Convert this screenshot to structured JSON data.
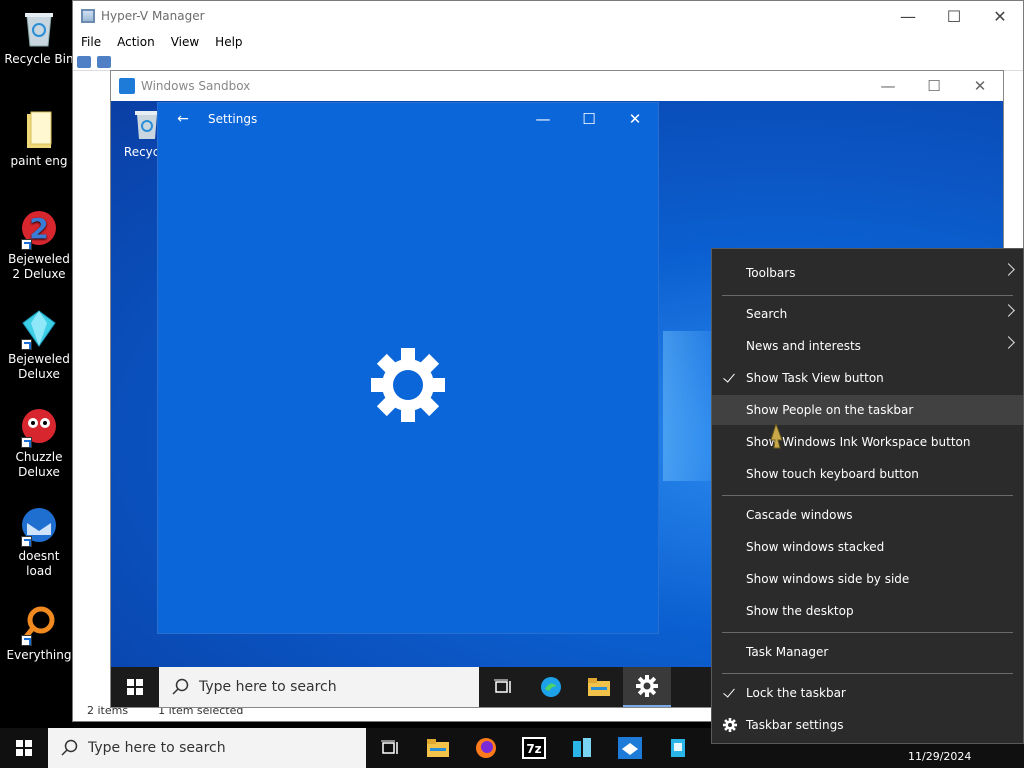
{
  "desktop": {
    "icons": [
      {
        "label": "Recycle Bin",
        "icon": "recycle-bin-icon"
      },
      {
        "label": "paint eng",
        "icon": "folder-icon"
      },
      {
        "label": "Bejeweled 2 Deluxe",
        "icon": "bejeweled2-icon"
      },
      {
        "label": "Bejeweled Deluxe",
        "icon": "bejeweled-icon"
      },
      {
        "label": "Chuzzle Deluxe",
        "icon": "chuzzle-icon"
      },
      {
        "label": "doesnt load",
        "icon": "thunderbird-icon"
      },
      {
        "label": "Everything",
        "icon": "everything-search-icon"
      }
    ]
  },
  "hyperv": {
    "title": "Hyper-V Manager",
    "menu": [
      "File",
      "Action",
      "View",
      "Help"
    ],
    "status_items": "2 items",
    "status_selected": "1 item selected"
  },
  "sandbox": {
    "title": "Windows Sandbox",
    "recycle_label": "Recycle",
    "search_placeholder": "Type here to search"
  },
  "settings": {
    "title": "Settings"
  },
  "taskbar": {
    "search_placeholder": "Type here to search",
    "date": "11/29/2024"
  },
  "context_menu": {
    "items": [
      {
        "label": "Toolbars",
        "submenu": true
      },
      {
        "label": "Search",
        "submenu": true
      },
      {
        "label": "News and interests",
        "submenu": true
      },
      {
        "label": "Show Task View button",
        "checked": true
      },
      {
        "label": "Show People on the taskbar",
        "highlighted": true
      },
      {
        "label": "Show Windows Ink Workspace button"
      },
      {
        "label": "Show touch keyboard button"
      },
      {
        "label": "Cascade windows"
      },
      {
        "label": "Show windows stacked"
      },
      {
        "label": "Show windows side by side"
      },
      {
        "label": "Show the desktop"
      },
      {
        "label": "Task Manager"
      },
      {
        "label": "Lock the taskbar",
        "checked": true
      },
      {
        "label": "Taskbar settings",
        "icon": "gear-icon"
      }
    ]
  }
}
